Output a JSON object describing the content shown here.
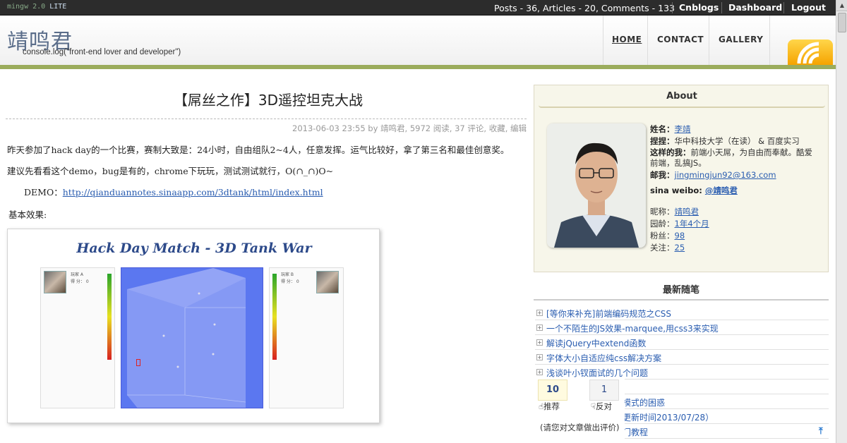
{
  "topbar": {
    "brand": "mingw 2.0",
    "brand_suffix": "LITE",
    "stats": "Posts - 36, Articles - 20, Comments - 133",
    "links": [
      "Cnblogs",
      "Dashboard",
      "Logout"
    ]
  },
  "header": {
    "site_title": "靖鸣君",
    "tagline": "console.log(\"front-end lover and developer\")",
    "nav": [
      "HOME",
      "CONTACT",
      "GALLERY"
    ]
  },
  "post": {
    "title": "【屌丝之作】3D遥控坦克大战",
    "meta": "2013-06-03 23:55 by 靖鸣君, 5972 阅读, 37 评论, 收藏, 编辑",
    "p1": "昨天参加了hack day的一个比赛，赛制大致是：24小时，自由组队2~4人，任意发挥。运气比较好，拿了第三名和最佳创意奖。",
    "p2": "建议先看看这个demo，bug是有的，chrome下玩玩，测试测试就行，O(∩_∩)O~",
    "demo_label": "DEMO：",
    "demo_url": "http://qianduannotes.sinaapp.com/3dtank/html/index.html",
    "p3": "基本效果:",
    "screenshot": {
      "game_title": "Hack Day Match - 3D Tank War",
      "player_a": "玩家 A",
      "player_b": "玩家 B",
      "score_a": "得 分：  0",
      "score_b": "得 分：  0"
    }
  },
  "sidebar": {
    "about_title": "About",
    "name_label": "姓名：",
    "name_value": "李靖",
    "school_label": "捏捏：",
    "school_value": "华中科技大学（在读） & 百度实习",
    "self_label": "这样的我：",
    "self_value_1": "前端小天屌，为自由而奉献。酷爱",
    "self_value_2": "前端，乱搞JS。",
    "email_label": "邮我：",
    "email_value": "jingmingjun92@163.com",
    "weibo_label": "sina weibo: ",
    "weibo_value": "@靖鸣君",
    "nick_label": "昵称：",
    "nick_value": "靖鸣君",
    "age_label": "园龄：",
    "age_value": "1年4个月",
    "fans_label": "粉丝：",
    "fans_value": "98",
    "follow_label": "关注：",
    "follow_value": "25",
    "recent_title": "最新随笔",
    "recent_items": [
      "[等你来补充]前端编码规范之CSS",
      "一个不陌生的JS效果-marquee,用css3来实现",
      "解读jQuery中extend函数",
      "字体大小自适应纯css解决方案",
      "浅谈叶小钗面试的几个问题",
      "模式的困惑",
      "更新时间2013/07/28）",
      "门教程"
    ]
  },
  "vote": {
    "up_count": "10",
    "down_count": "1",
    "up_label": "推荐",
    "down_label": "反对",
    "note": "(请您对文章做出评价)"
  },
  "colors": {
    "accent_green": "#9bac5c",
    "link_blue": "#2a5db0",
    "arena_blue": "#5b77f0"
  }
}
